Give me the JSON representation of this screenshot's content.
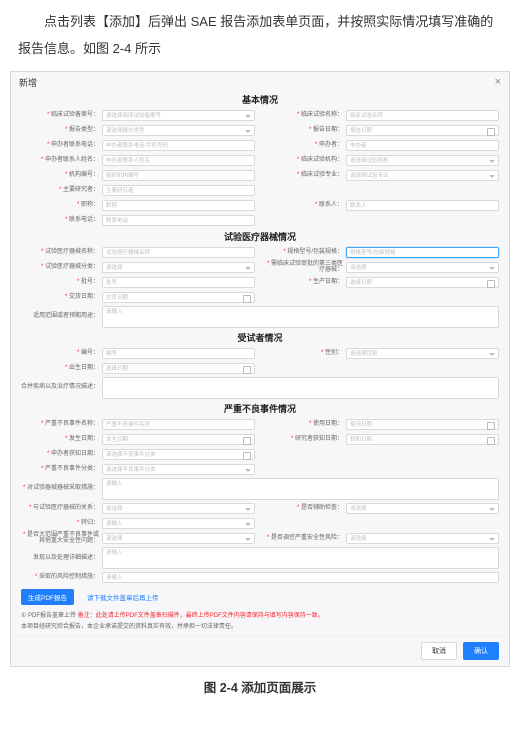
{
  "intro": "点击列表【添加】后弹出 SAE 报告添加表单页面，并按照实际情况填写准确的报告信息。如图 2-4 所示",
  "caption": "图 2-4 添加页面展示",
  "modal": {
    "title": "新增",
    "close": "×"
  },
  "sects": {
    "s1": "基本情况",
    "s2": "试验医疗器械情况",
    "s3": "受试者情况",
    "s4": "严重不良事件情况"
  },
  "ph": {
    "regno": "请选择临床试验备案号",
    "trialname": "临床试验名称",
    "rpttype": "请选择报告类型",
    "rptdate": "报告日期",
    "sponsortel": "申办者联系电话/手机号码",
    "sponsor": "申办者",
    "agentname": "申办者联系人姓名",
    "tester": "请选择试验机构",
    "testmajor": "请选择试验专业",
    "org": "组织机构编号",
    "pi": "主要研究者",
    "title": "职称",
    "contact": "联系人",
    "tel": "联系电话",
    "devname": "试验医疗器械名称",
    "model": "规格型号/包装规格",
    "devclass": "请选择",
    "need3": "请选择",
    "lot": "批号",
    "mfgdate": "选择日期",
    "impdate": "交货日期",
    "usage": "请输入",
    "code": "编号",
    "gender": "请选择性别",
    "birth": "选择日期",
    "saename": "严重不良事件名称",
    "usedate": "使用日期",
    "occdate": "发生日期",
    "awaredate": "获知日期",
    "cont": "请选择不良事件分类",
    "event": "请选择不良事件分类",
    "measures": "请输入",
    "auxex": "请选择",
    "outcome": "请输入",
    "safety": "请选择",
    "other": "请输入",
    "risk": "请输入"
  },
  "lbl": {
    "regno": "临床试验备案号：",
    "trialname": "临床试验名称：",
    "rpttype": "报告类型：",
    "rptdate": "报告日期：",
    "sponsortel": "申办者联系电话：",
    "sponsor": "申办者：",
    "agentname": "申办者联系人姓名：",
    "tester": "临床试验机构：",
    "testmajor": "临床试验专业：",
    "org": "机构编号：",
    "pi": "主要研究者：",
    "title": "职称：",
    "contact": "联系人：",
    "tel": "联系电话：",
    "devname": "试验医疗器械名称：",
    "model": "规格型号/包装规格：",
    "devclass": "试验医疗器械分类：",
    "need3": "需临床试验审批的第三类医疗器械：",
    "lot": "批号：",
    "mfgdate": "生产日期：",
    "impdate": "交货日期：",
    "usage": "适用范围或者预期用途：",
    "code": "编号：",
    "gender": "性别：",
    "birth": "出生日期：",
    "history": "合并疾病以及治疗情况描述：",
    "saename": "严重不良事件名称：",
    "usedate": "使用日期：",
    "occdate": "发生日期：",
    "awaredate": "研究者获知日期：",
    "cont": "申办者获知日期：",
    "event": "严重不良事件分类：",
    "measures": "对试验器械器械采取措施：",
    "auxex": "与试验医疗器械的关系：",
    "outcome": "转归：",
    "safety": "是否辅助检查：",
    "bigrisk": "是否大范围严重不良事件或其他重大安全性问题：",
    "safeplan": "是否调控严重安全性风险：",
    "other": "发现以及处理详细描述：",
    "risk": "采取的风险控制措施："
  },
  "btns": {
    "gen": "生成PDF报告",
    "upl": "请下载文件盖章后再上传"
  },
  "notes": {
    "n1a": "PDF报告盖章上传",
    "n1b": "备注：此处请上传PDF文件盖章扫描件，最终上传PDF文件内容请保持与填写内容保持一致。",
    "n2": "本项目经研究综合报告，本企业承诺提交的资料真实有效，并承担一切法律责任。"
  },
  "ftr": {
    "cancel": "取消",
    "ok": "确认"
  }
}
